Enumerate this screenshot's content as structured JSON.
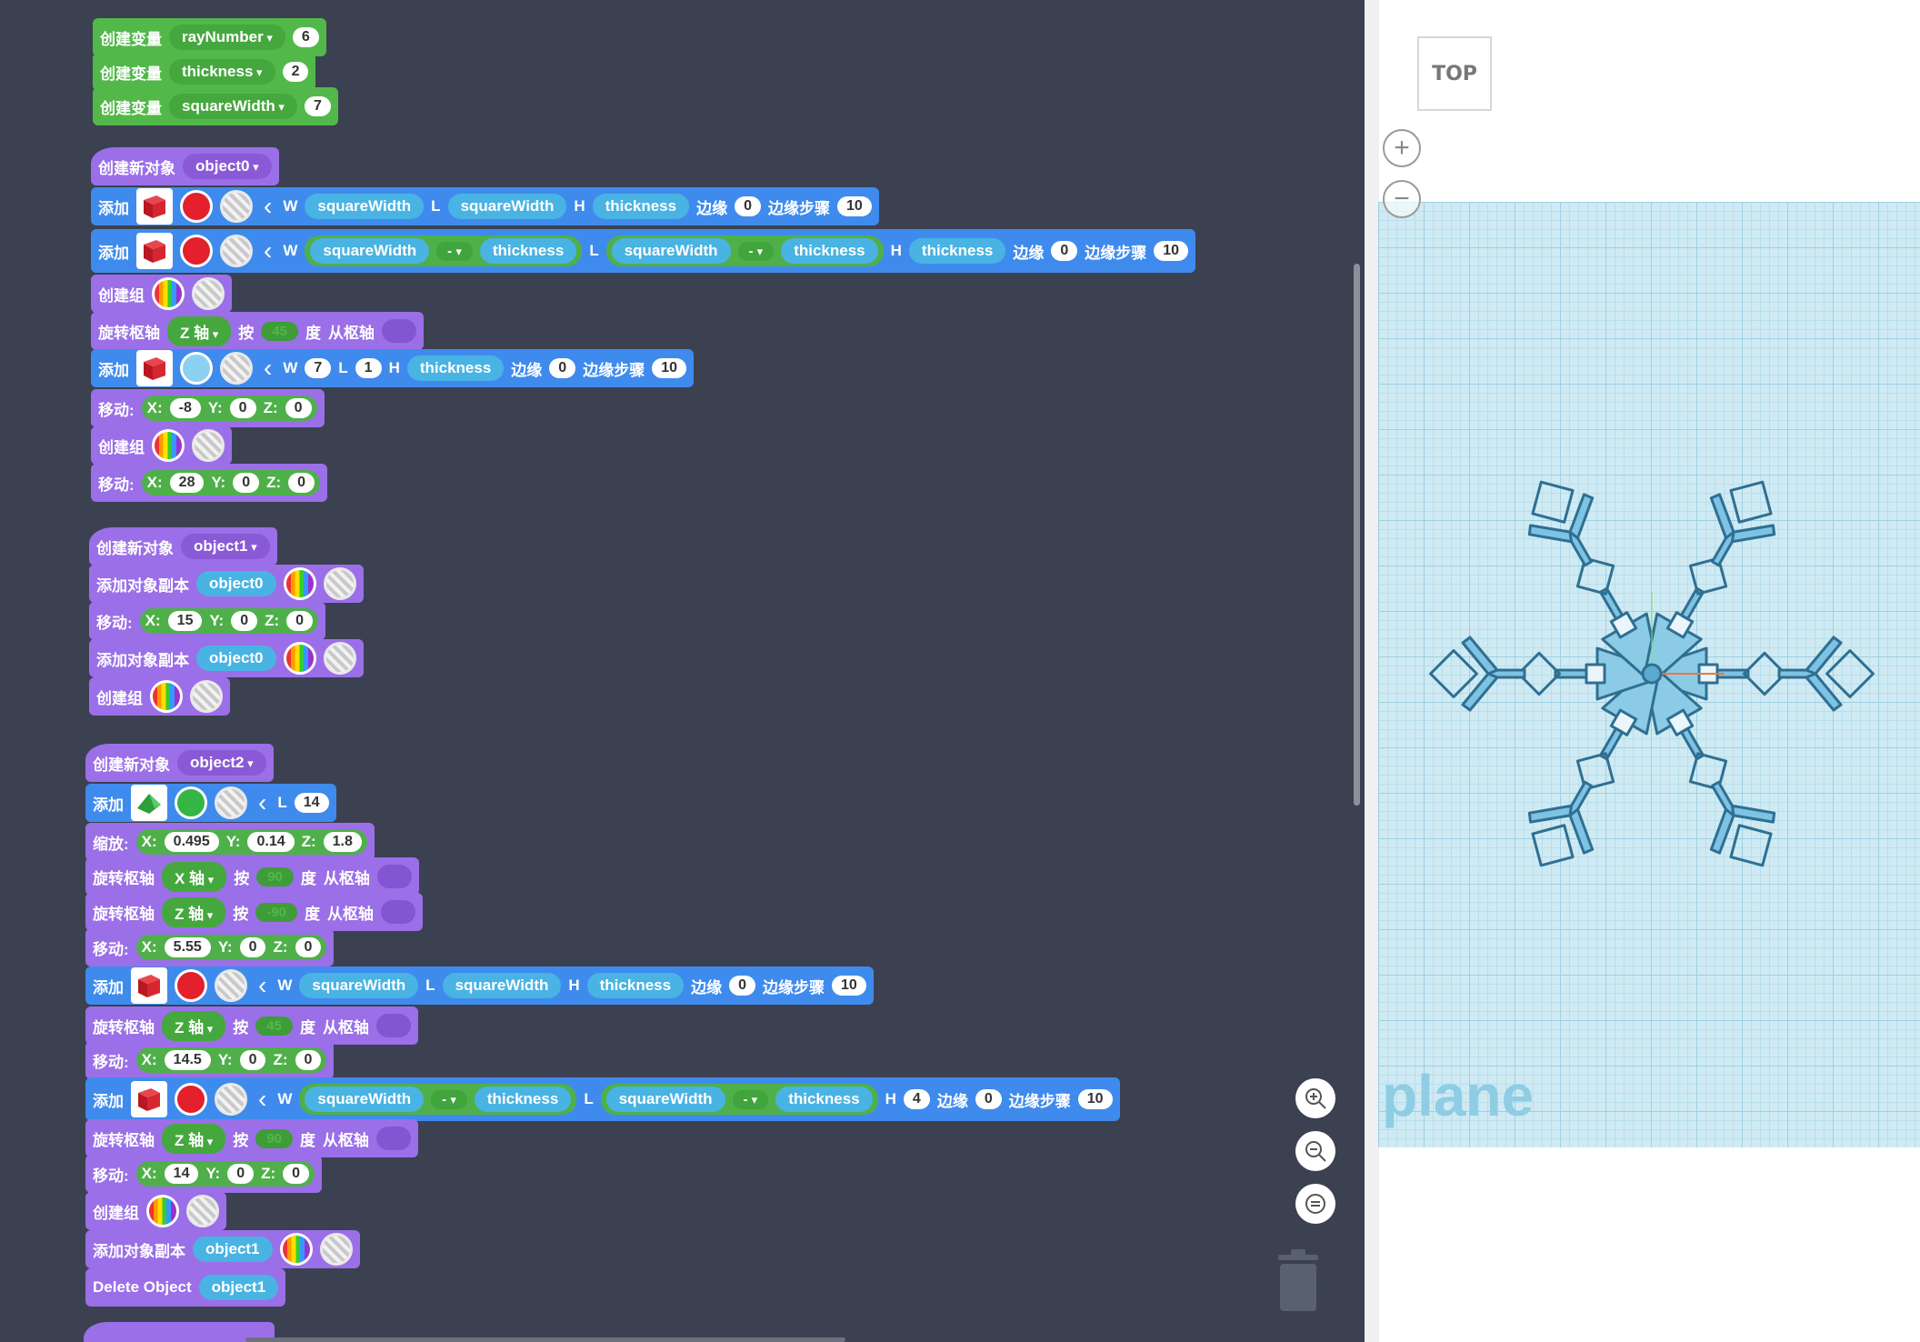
{
  "workspace": {
    "vars": [
      {
        "label": "创建变量",
        "name": "rayNumber",
        "value": "6"
      },
      {
        "label": "创建变量",
        "name": "thickness",
        "value": "2"
      },
      {
        "label": "创建变量",
        "name": "squareWidth",
        "value": "7"
      }
    ],
    "kw": {
      "new_object": "创建新对象",
      "add": "添加",
      "create_group": "创建组",
      "rotate": "旋转枢轴",
      "by": "按",
      "deg": "度",
      "from_axis": "从枢轴",
      "move": "移动:",
      "scale": "缩放:",
      "add_copy": "添加对象副本",
      "edge": "边缘",
      "edge_steps": "边缘步骤",
      "delete_object": "Delete Object",
      "W": "W",
      "L": "L",
      "H": "H",
      "X": "X:",
      "Y": "Y:",
      "Z": "Z:",
      "z_axis": "Z 轴",
      "x_axis": "X 轴",
      "minus": "- "
    },
    "objects": [
      "object0",
      "object1",
      "object2"
    ],
    "vals": {
      "thickness": "thickness",
      "squareWidth": "squareWidth",
      "zero": "0",
      "ten": "10",
      "r45": "45",
      "r90": "90",
      "rm90": "-90",
      "n7": "7",
      "n1": "1",
      "n4": "4",
      "n14": "14",
      "mx1": "-8",
      "mx2": "28",
      "mx3": "15",
      "sx": "0.495",
      "sy": "0.14",
      "sz": "1.8",
      "mx4": "5.55",
      "mx5": "14.5",
      "mx6": "14"
    }
  },
  "viewport": {
    "viewcube_label": "TOP",
    "zoom_in_symbol": "+",
    "zoom_out_symbol": "−",
    "plane_label": "plane"
  },
  "colors": {
    "block_purple": "#9b6fe8",
    "block_green": "#52b84a",
    "block_blue": "#3f8bed",
    "workspace_bg": "#3b4151",
    "snowflake": "#7ec3e3"
  }
}
